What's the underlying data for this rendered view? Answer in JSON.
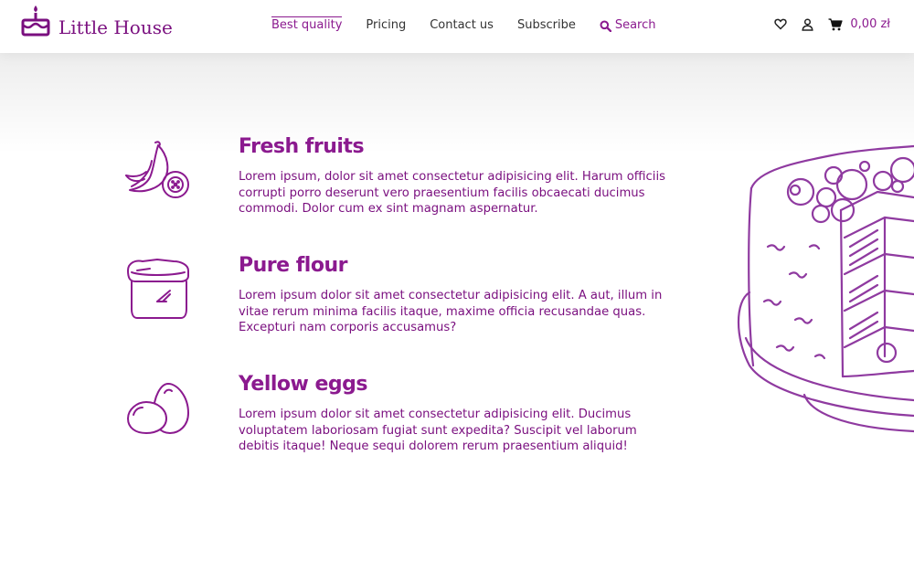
{
  "brand": {
    "name": "Little House",
    "color": "#7a0f7f"
  },
  "nav": {
    "items": [
      {
        "label": "Best quality",
        "active": true
      },
      {
        "label": "Pricing",
        "active": false
      },
      {
        "label": "Contact us",
        "active": false
      },
      {
        "label": "Subscribe",
        "active": false
      }
    ],
    "search_label": "Search"
  },
  "header_actions": {
    "wishlist_icon": "heart-icon",
    "account_icon": "user-icon",
    "cart_icon": "cart-icon",
    "cart_total": "0,00 zł"
  },
  "features": [
    {
      "icon": "banana-fruit-icon",
      "title": "Fresh fruits",
      "text": "Lorem ipsum, dolor sit amet consectetur adipisicing elit. Harum officiis corrupti porro deserunt vero praesentium facilis obcaecati ducimus commodi. Dolor cum ex sint magnam aspernatur."
    },
    {
      "icon": "flour-sack-icon",
      "title": "Pure flour",
      "text": "Lorem ipsum dolor sit amet consectetur adipisicing elit. A aut, illum in vitae rerum minima facilis itaque, maxime officia recusandae quas. Excepturi nam corporis accusamus?"
    },
    {
      "icon": "eggs-icon",
      "title": "Yellow eggs",
      "text": "Lorem ipsum dolor sit amet consectetur adipisicing elit. Ducimus voluptatem laboriosam fugiat sunt expedita? Suscipit vel laborum debitis itaque! Neque sequi dolorem rerum praesentium aliquid!"
    }
  ],
  "illustration": "cake-illustration",
  "accent_color": "#8b1a8f"
}
